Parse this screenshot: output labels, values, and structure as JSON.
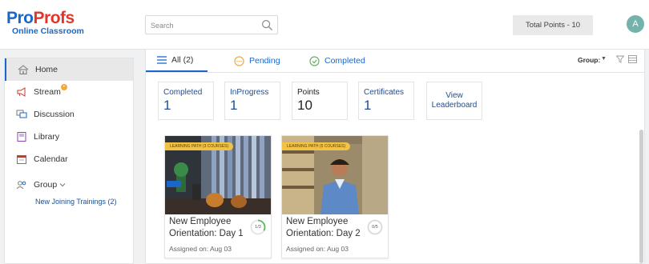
{
  "logo": {
    "part1": "Pro",
    "part2": "Profs",
    "subtitle": "Online Classroom"
  },
  "search": {
    "placeholder": "Search",
    "value": ""
  },
  "header": {
    "total_points": "Total Points - 10",
    "avatar_initial": "A"
  },
  "sidebar": {
    "items": [
      {
        "label": "Home",
        "icon": "home-icon"
      },
      {
        "label": "Stream",
        "icon": "megaphone-icon"
      },
      {
        "label": "Discussion",
        "icon": "chat-icon"
      },
      {
        "label": "Library",
        "icon": "book-icon"
      },
      {
        "label": "Calendar",
        "icon": "calendar-icon"
      },
      {
        "label": "Group",
        "icon": "group-icon"
      }
    ],
    "group_sub": "New Joining Trainings (2)"
  },
  "tabs": {
    "all": "All (2)",
    "pending": "Pending",
    "completed": "Completed",
    "group_label": "Group:"
  },
  "stats": {
    "completed": {
      "label": "Completed",
      "value": "1"
    },
    "inprogress": {
      "label": "InProgress",
      "value": "1"
    },
    "points": {
      "label": "Points",
      "value": "10"
    },
    "certificates": {
      "label": "Certificates",
      "value": "1"
    },
    "leaderboard": {
      "line1": "View",
      "line2": "Leaderboard"
    }
  },
  "cards": [
    {
      "tag": "LEARNING PATH (3 COURSES)",
      "title": "New Employee Orientation: Day 1",
      "progress": "1/3",
      "progress_fraction": 0.333,
      "assigned": "Assigned on: Aug 03"
    },
    {
      "tag": "LEARNING PATH (5 COURSES)",
      "title": "New Employee Orientation: Day 2",
      "progress": "0/5",
      "progress_fraction": 0,
      "assigned": "Assigned on: Aug 03"
    }
  ],
  "colors": {
    "brand_blue": "#1b66c9",
    "brand_red": "#e2352c",
    "progress_green": "#5cb85c",
    "tag_yellow": "#f2c244"
  }
}
